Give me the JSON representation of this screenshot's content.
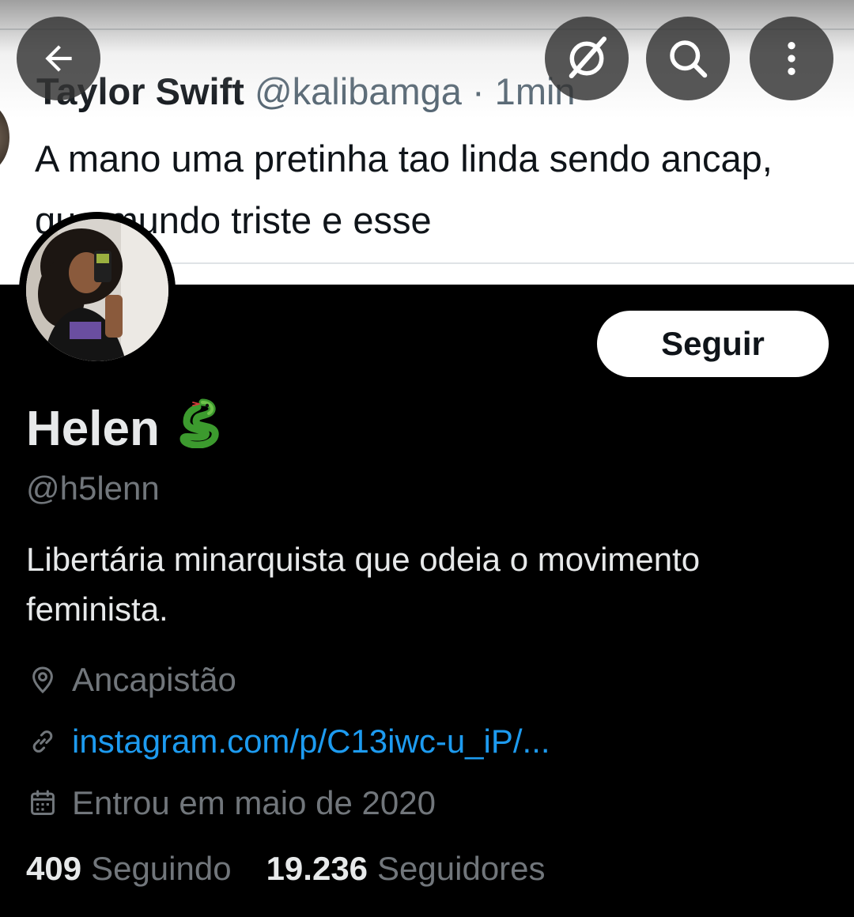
{
  "banner": {
    "quoted_tweet": {
      "author_name": "Taylor Swift",
      "author_handle": "@kalibamga",
      "time": "· 1min",
      "text": "A mano uma pretinha tao linda sendo ancap, que mundo triste e esse"
    }
  },
  "top_actions": {
    "back_icon": "arrow-left-icon",
    "grok_icon": "grok-icon",
    "search_icon": "search-icon",
    "more_icon": "more-vertical-icon"
  },
  "profile": {
    "display_name": "Helen",
    "name_emoji": "snake-emoji",
    "handle": "@h5lenn",
    "bio": "Libertária minarquista que odeia o movimento feminista.",
    "location": "Ancapistão",
    "website": "instagram.com/p/C13iwc-u_iP/...",
    "joined": "Entrou em maio de 2020",
    "follow_label": "Seguir"
  },
  "stats": {
    "following_count": "409",
    "following_label": "Seguindo",
    "followers_count": "19.236",
    "followers_label": "Seguidores"
  },
  "colors": {
    "background": "#000000",
    "link": "#1d9bf0",
    "secondary_text": "#71767b",
    "primary_text": "#e7e9ea"
  }
}
